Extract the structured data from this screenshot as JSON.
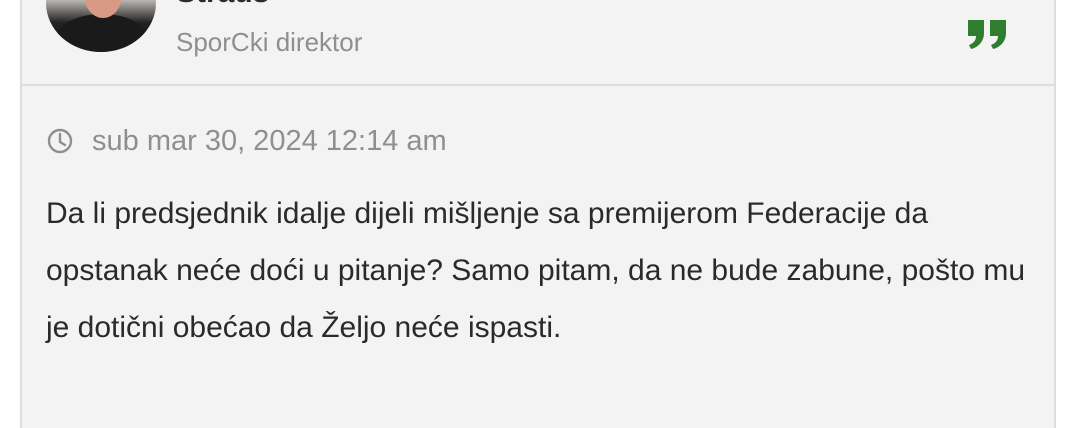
{
  "author": {
    "name": "Straus",
    "rank": "SporCki direktor"
  },
  "post": {
    "date": "sub mar 30, 2024 12:14 am",
    "content": "Da li predsjednik idalje dijeli mišljenje sa premijerom Federacije da opstanak neće doći u pitanje? Samo pitam, da ne bude zabune, pošto mu je dotični obećao da Željo neće ispasti."
  },
  "icons": {
    "quote": "quote-icon",
    "clock": "clock-icon"
  },
  "colors": {
    "quote_accent": "#2f7d2f",
    "meta_text": "#8f8f8f",
    "card_background": "#f3f3f3",
    "body_text": "#2a2a2a"
  }
}
